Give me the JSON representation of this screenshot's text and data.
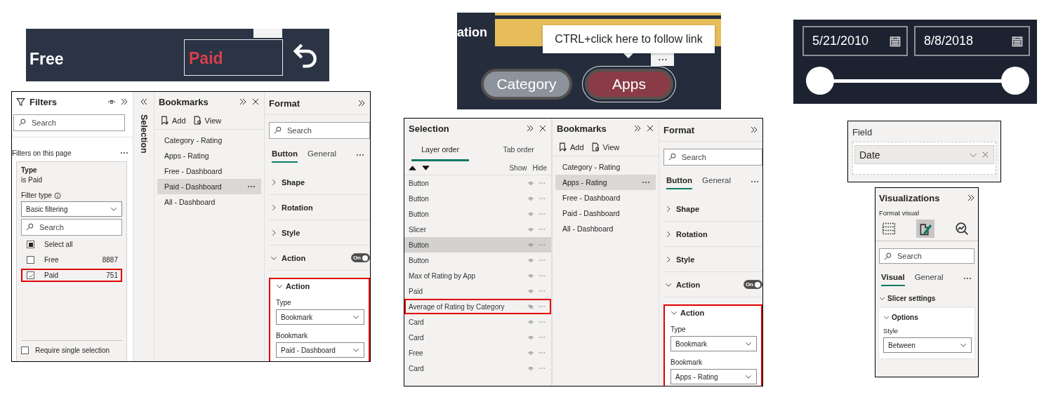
{
  "paid_banner": {
    "free_button": "Free",
    "paid_button": {
      "label": "Paid",
      "selected": true
    }
  },
  "report_a": {
    "filters": {
      "title": "Filters",
      "search": {
        "placeholder": "Search"
      },
      "scope": "Filters on this page",
      "card": {
        "title": "Type",
        "summary": "is Paid",
        "filter_type_label": "Filter type",
        "filter_type": "Basic filtering",
        "search": {
          "placeholder": "Search"
        },
        "items": [
          {
            "kind": "select-all",
            "label": "Select all",
            "checked": true,
            "highlighted": false
          },
          {
            "kind": "option",
            "label": "Free",
            "count": "8887",
            "checked": false,
            "highlighted": false
          },
          {
            "kind": "option",
            "label": "Paid",
            "count": "751",
            "checked": true,
            "highlighted": true
          }
        ],
        "require_single": {
          "label": "Require single selection",
          "checked": false
        }
      }
    },
    "selection_tab": {
      "label": "Selection"
    },
    "bookmarks": {
      "title": "Bookmarks",
      "add": "Add",
      "view": "View",
      "items": [
        {
          "label": "Category - Rating",
          "selected": false
        },
        {
          "label": "Apps - Rating",
          "selected": false
        },
        {
          "label": "Free - Dashboard",
          "selected": false
        },
        {
          "label": "Paid - Dashboard",
          "selected": true
        },
        {
          "label": "All - Dashboard",
          "selected": false
        }
      ]
    },
    "format": {
      "title": "Format",
      "search": {
        "placeholder": "Search"
      },
      "tabs": [
        {
          "label": "Button",
          "selected": true
        },
        {
          "label": "General",
          "selected": false
        }
      ],
      "sections": [
        {
          "label": "Shape",
          "expanded": false
        },
        {
          "label": "Rotation",
          "expanded": false
        },
        {
          "label": "Style",
          "expanded": false
        },
        {
          "label": "Action",
          "expanded": true,
          "toggle": {
            "label": "On",
            "on": true
          }
        }
      ],
      "action_card": {
        "title": "Action",
        "expanded": true,
        "highlighted": true,
        "type_label": "Type",
        "type": "Bookmark",
        "bookmark_label": "Bookmark",
        "bookmark": "Paid - Dashboard"
      }
    }
  },
  "apps_banner": {
    "partial_label": "ation",
    "tooltip": "CTRL+click here to follow link",
    "buttons": [
      {
        "label": "Category",
        "selected": false
      },
      {
        "label": "Apps",
        "selected": true
      }
    ]
  },
  "report_b": {
    "selection": {
      "title": "Selection",
      "tabs": [
        {
          "label": "Layer order",
          "selected": true
        },
        {
          "label": "Tab order",
          "selected": false
        }
      ],
      "show_label": "Show",
      "hide_label": "Hide",
      "layers": [
        {
          "label": "Button",
          "selected": false,
          "visible": true,
          "highlighted": false
        },
        {
          "label": "Button",
          "selected": false,
          "visible": true,
          "highlighted": false
        },
        {
          "label": "Button",
          "selected": false,
          "visible": true,
          "highlighted": false
        },
        {
          "label": "Slicer",
          "selected": false,
          "visible": true,
          "highlighted": false
        },
        {
          "label": "Button",
          "selected": true,
          "visible": true,
          "highlighted": false
        },
        {
          "label": "Button",
          "selected": false,
          "visible": true,
          "highlighted": false
        },
        {
          "label": "Max of Rating by App",
          "selected": false,
          "visible": true,
          "highlighted": false
        },
        {
          "label": "Paid",
          "selected": false,
          "visible": true,
          "highlighted": false
        },
        {
          "label": "Average of Rating by Category",
          "selected": false,
          "visible": false,
          "highlighted": true
        },
        {
          "label": "Card",
          "selected": false,
          "visible": true,
          "highlighted": false
        },
        {
          "label": "Card",
          "selected": false,
          "visible": true,
          "highlighted": false
        },
        {
          "label": "Free",
          "selected": false,
          "visible": true,
          "highlighted": false
        },
        {
          "label": "Card",
          "selected": false,
          "visible": true,
          "highlighted": false
        }
      ]
    },
    "bookmarks": {
      "title": "Bookmarks",
      "add": "Add",
      "view": "View",
      "items": [
        {
          "label": "Category - Rating",
          "selected": false
        },
        {
          "label": "Apps - Rating",
          "selected": true
        },
        {
          "label": "Free - Dashboard",
          "selected": false
        },
        {
          "label": "Paid - Dashboard",
          "selected": false
        },
        {
          "label": "All - Dashboard",
          "selected": false
        }
      ]
    },
    "format": {
      "title": "Format",
      "search": {
        "placeholder": "Search"
      },
      "tabs": [
        {
          "label": "Button",
          "selected": true
        },
        {
          "label": "General",
          "selected": false
        }
      ],
      "sections": [
        {
          "label": "Shape",
          "expanded": false
        },
        {
          "label": "Rotation",
          "expanded": false
        },
        {
          "label": "Style",
          "expanded": false
        },
        {
          "label": "Action",
          "expanded": true,
          "toggle": {
            "label": "On",
            "on": true
          }
        }
      ],
      "action_card": {
        "title": "Action",
        "expanded": true,
        "highlighted": true,
        "type_label": "Type",
        "type": "Bookmark",
        "bookmark_label": "Bookmark",
        "bookmark": "Apps - Rating"
      }
    }
  },
  "date_slicer": {
    "start": "5/21/2010",
    "end": "8/8/2018",
    "handles": [
      {
        "level": 0
      },
      {
        "level": 1
      }
    ]
  },
  "field_well": {
    "title": "Field",
    "field": "Date"
  },
  "visualizations": {
    "title": "Visualizations",
    "subtitle": "Format visual",
    "views": [
      {
        "kind": "build",
        "selected": false
      },
      {
        "kind": "format",
        "selected": true
      },
      {
        "kind": "analytics",
        "selected": false
      }
    ],
    "search": {
      "placeholder": "Search"
    },
    "tabs": [
      {
        "label": "Visual",
        "selected": true
      },
      {
        "label": "General",
        "selected": false
      }
    ],
    "section": {
      "label": "Slicer settings",
      "expanded": true
    },
    "card": {
      "label": "Options",
      "expanded": true,
      "style_label": "Style",
      "style_value": "Between"
    }
  }
}
